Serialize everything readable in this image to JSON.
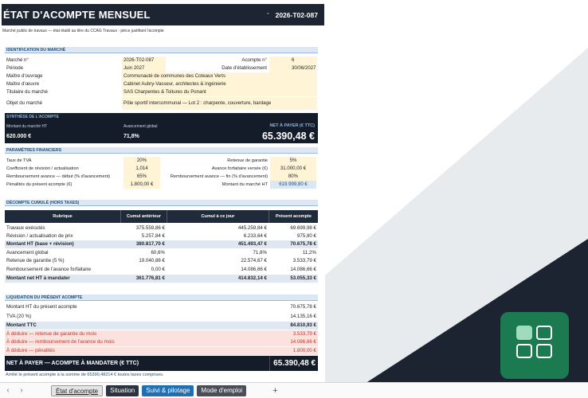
{
  "header": {
    "title": "ÉTAT D'ACOMPTE MENSUEL",
    "ref_symbol": "°",
    "ref": "2026-T02-087"
  },
  "subtitle": "Marché public de travaux — état établi au titre du CCAG Travaux · pièce justifiant l'acompte",
  "identification": {
    "section": "IDENTIFICATION DU MARCHÉ",
    "rows": [
      {
        "label": "Marché n°",
        "value": "2026-T02-087",
        "label2": "Acompte n°",
        "value2": "6"
      },
      {
        "label": "Période",
        "value": "Juin 2027",
        "label2": "Date d'établissement",
        "value2": "30/06/2027"
      },
      {
        "label": "Maître d'ouvrage",
        "value": "Communauté de communes des Coteaux Verts"
      },
      {
        "label": "Maître d'œuvre",
        "value": "Cabinet Aubry-Vasseur, architectes & ingénierie"
      },
      {
        "label": "Titulaire du marché",
        "value": "SAS Charpentes & Toitures du Ponant"
      },
      {
        "label": "Objet du marché",
        "value": "Pôle sportif intercommunal — Lot 2 : charpente, couverture, bardage"
      }
    ]
  },
  "synthese": {
    "section": "SYNTHÈSE DE L'ACOMPTE",
    "montant_label": "Montant du marché HT",
    "montant_value": "620.000 €",
    "avancement_label": "Avancement global",
    "avancement_value": "71,8%",
    "net_label": "NET À PAYER (€ TTC)",
    "net_value": "65.390,48 €"
  },
  "parametres": {
    "section": "PARAMÈTRES FINANCIERS",
    "rows": [
      {
        "label": "Taux de TVA",
        "value": "20%",
        "label2": "Retenue de garantie",
        "value2": "5%"
      },
      {
        "label": "Coefficient de révision / actualisation",
        "value": "1,014",
        "label2": "Avance forfaitaire versée (€)",
        "value2": "31.000,00 €"
      },
      {
        "label": "Remboursement avance — début (% d'avancement)",
        "value": "65%",
        "label2": "Remboursement avance — fin (% d'avancement)",
        "value2": "80%"
      },
      {
        "label": "Pénalités du présent acompte (€)",
        "value": "1.800,00 €",
        "label2": "Montant du marché HT",
        "value2": "619.999,80 €"
      }
    ]
  },
  "decompte": {
    "section": "DÉCOMPTE CUMULÉ (HORS TAXES)",
    "columns": [
      "Rubrique",
      "Cumul antérieur",
      "Cumul à ce jour",
      "Présent acompte"
    ],
    "rows": [
      {
        "label": "Travaux exécutés",
        "a": "375.559,86 €",
        "b": "445.259,84 €",
        "c": "69.699,98 €",
        "bold": false
      },
      {
        "label": "Révision / actualisation de prix",
        "a": "5.257,84 €",
        "b": "6.233,64 €",
        "c": "975,80 €",
        "bold": false
      },
      {
        "label": "Montant HT (base + révision)",
        "a": "380.817,70 €",
        "b": "451.493,47 €",
        "c": "70.675,78 €",
        "bold": true
      },
      {
        "label": "Avancement global",
        "a": "60,6%",
        "b": "71,8%",
        "c": "11,2%",
        "bold": false
      },
      {
        "label": "Retenue de garantie (5 %)",
        "a": "19.040,88 €",
        "b": "22.574,67 €",
        "c": "3.533,79 €",
        "bold": false
      },
      {
        "label": "Remboursement de l'avance forfaitaire",
        "a": "0,00 €",
        "b": "14.086,66 €",
        "c": "14.086,66 €",
        "bold": false
      },
      {
        "label": "Montant net HT à mandater",
        "a": "361.776,81 €",
        "b": "414.832,14 €",
        "c": "53.055,33 €",
        "bold": true
      }
    ]
  },
  "liquidation": {
    "section": "LIQUIDATION DU PRÉSENT ACOMPTE",
    "rows": [
      {
        "label": "Montant HT du présent acompte",
        "value": "70.675,78 €"
      },
      {
        "label": "TVA (20 %)",
        "value": "14.135,16 €"
      },
      {
        "label": "Montant TTC",
        "value": "84.810,93 €"
      },
      {
        "label": "À déduire — retenue de garantie du mois",
        "value": "3.533,79 €"
      },
      {
        "label": "À déduire — remboursement de l'avance du mois",
        "value": "14.086,66 €"
      },
      {
        "label": "À déduire — pénalités",
        "value": "1.800,00 €"
      }
    ],
    "final_label": "NET À PAYER — ACOMPTE À MANDATER (€ TTC)",
    "final_value": "65.390,48 €"
  },
  "footer_note": "Arrêté le présent acompte à la somme de 65390,48214 € toutes taxes comprises.",
  "tabs": {
    "prev": "‹",
    "next": "›",
    "items": [
      "État d'acompte",
      "Situation",
      "Suivi & pilotage",
      "Mode d'emploi"
    ],
    "add": "+"
  }
}
